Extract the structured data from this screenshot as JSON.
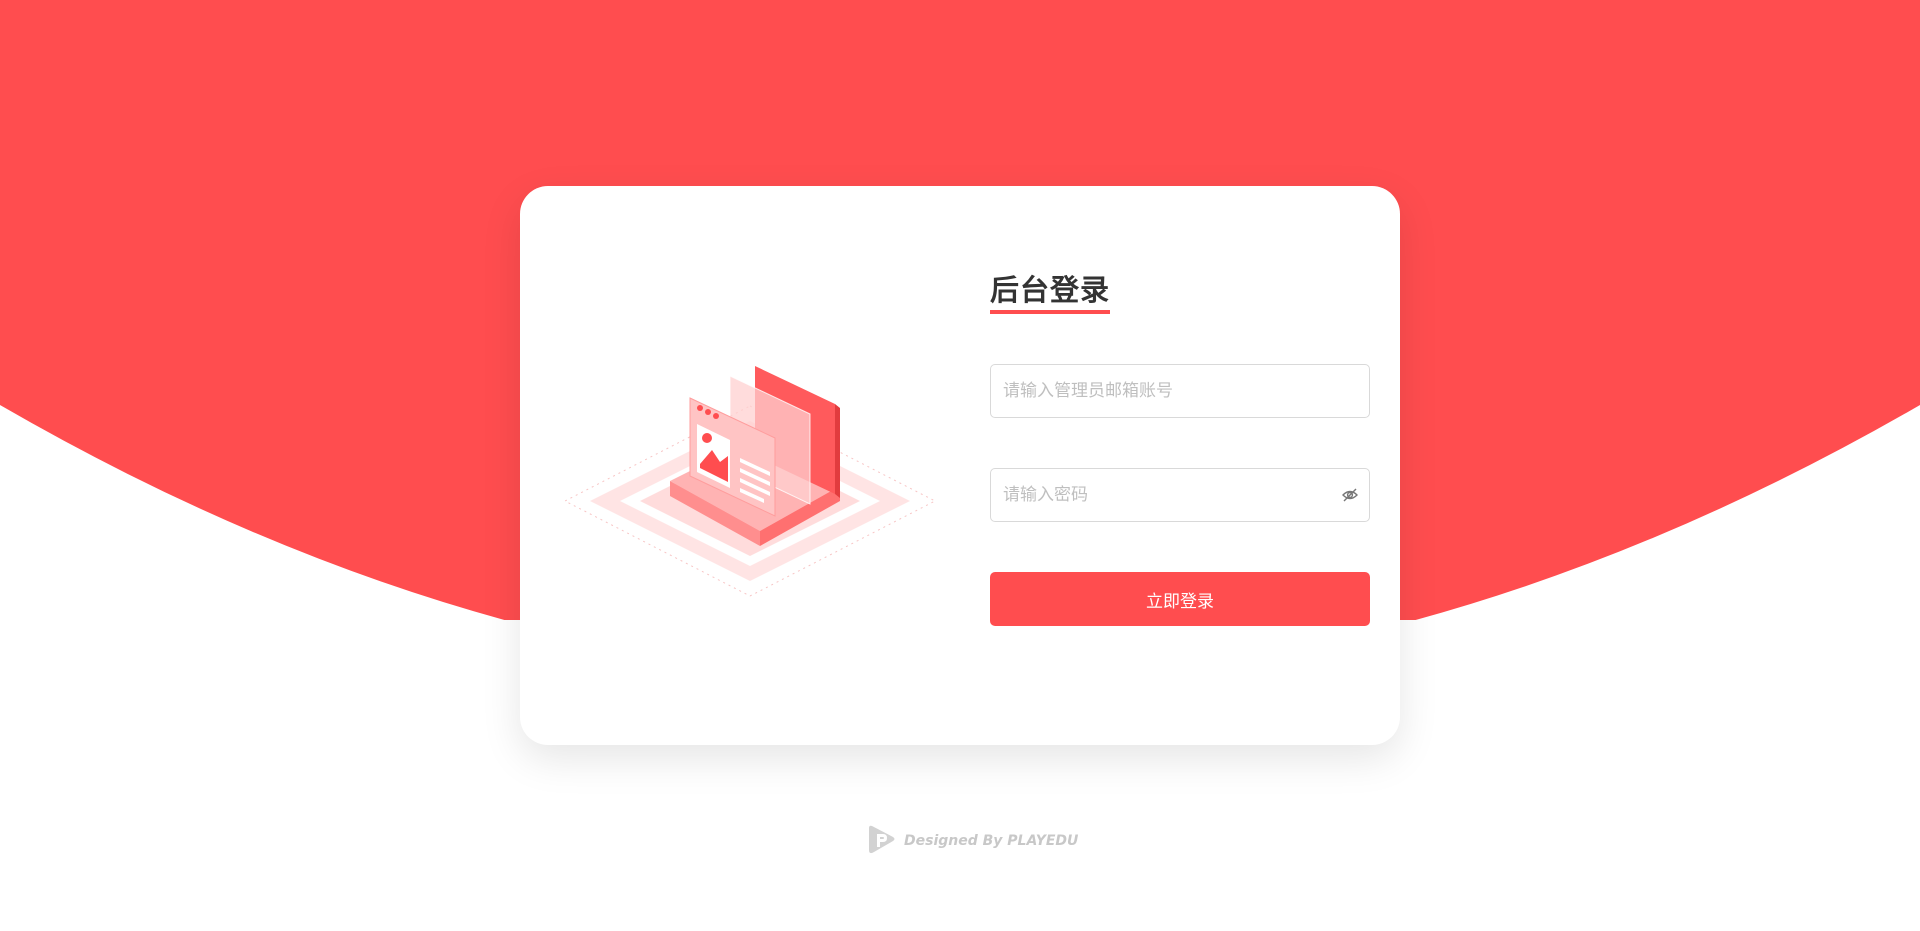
{
  "theme": {
    "brand_color": "#ff4d4f",
    "background_color": "#ffffff",
    "input_border_color": "#d9d9d9",
    "placeholder_color": "#bfbfbf"
  },
  "login": {
    "title": "后台登录",
    "email": {
      "placeholder": "请输入管理员邮箱账号",
      "value": ""
    },
    "password": {
      "placeholder": "请输入密码",
      "value": "",
      "toggle_icon": "eye-invisible-icon"
    },
    "submit_label": "立即登录"
  },
  "illustration": {
    "icon": "isometric-browser-window-illustration"
  },
  "footer": {
    "logo_icon": "playedu-logo-icon",
    "text": "Designed By PLAYEDU"
  }
}
